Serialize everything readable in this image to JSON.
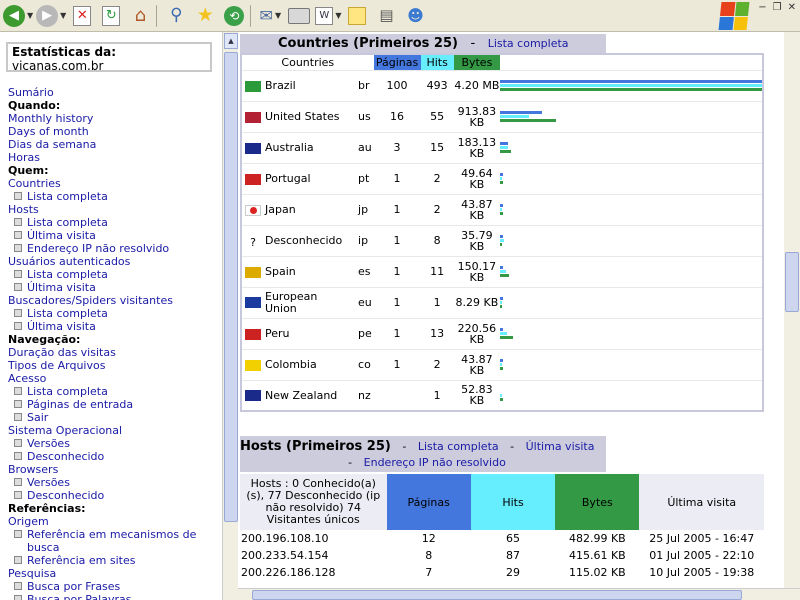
{
  "sidebar": {
    "site_label": "Estatísticas da:",
    "site_name": "vicanas.com.br",
    "menu": [
      {
        "kind": "l",
        "text": "Sumário"
      },
      {
        "kind": "h",
        "text": "Quando:"
      },
      {
        "kind": "l",
        "text": "Monthly history"
      },
      {
        "kind": "l",
        "text": "Days of month"
      },
      {
        "kind": "l",
        "text": "Dias da semana"
      },
      {
        "kind": "l",
        "text": "Horas"
      },
      {
        "kind": "h",
        "text": "Quem:"
      },
      {
        "kind": "l",
        "text": "Countries"
      },
      {
        "kind": "s",
        "text": "Lista completa"
      },
      {
        "kind": "l",
        "text": "Hosts"
      },
      {
        "kind": "s",
        "text": "Lista completa"
      },
      {
        "kind": "s",
        "text": "Última visita"
      },
      {
        "kind": "s",
        "text": "Endereço IP não resolvido"
      },
      {
        "kind": "l",
        "text": "Usuários autenticados"
      },
      {
        "kind": "s",
        "text": "Lista completa"
      },
      {
        "kind": "s",
        "text": "Última visita"
      },
      {
        "kind": "l",
        "text": "Buscadores/Spiders visitantes"
      },
      {
        "kind": "s",
        "text": "Lista completa"
      },
      {
        "kind": "s",
        "text": "Última visita"
      },
      {
        "kind": "h",
        "text": "Navegação:"
      },
      {
        "kind": "l",
        "text": "Duração das visitas"
      },
      {
        "kind": "l",
        "text": "Tipos de Arquivos"
      },
      {
        "kind": "l",
        "text": "Acesso"
      },
      {
        "kind": "s",
        "text": "Lista completa"
      },
      {
        "kind": "s",
        "text": "Páginas de entrada"
      },
      {
        "kind": "s",
        "text": "Sair"
      },
      {
        "kind": "l",
        "text": "Sistema Operacional"
      },
      {
        "kind": "s",
        "text": "Versões"
      },
      {
        "kind": "s",
        "text": "Desconhecido"
      },
      {
        "kind": "l",
        "text": "Browsers"
      },
      {
        "kind": "s",
        "text": "Versões"
      },
      {
        "kind": "s",
        "text": "Desconhecido"
      },
      {
        "kind": "h",
        "text": "Referências:"
      },
      {
        "kind": "l",
        "text": "Origem"
      },
      {
        "kind": "s",
        "text": "Referência em mecanismos de busca"
      },
      {
        "kind": "s",
        "text": "Referência em sites"
      },
      {
        "kind": "l",
        "text": "Pesquisa"
      },
      {
        "kind": "s",
        "text": "Busca por Frases"
      },
      {
        "kind": "s",
        "text": "Busca por Palavras"
      }
    ]
  },
  "countries": {
    "title": "Countries (Primeiros 25)",
    "dash": "-",
    "link": "Lista completa",
    "headers": {
      "country": "Countries",
      "pages": "Páginas",
      "hits": "Hits",
      "bytes": "Bytes"
    },
    "colors": {
      "pages": "#4477dd",
      "hits": "#66eeff",
      "bytes": "#339944"
    },
    "rows": [
      {
        "name": "Brazil",
        "code": "br",
        "pages": "100",
        "hits": "493",
        "bytes": "4.20 MB",
        "bp": 1.0,
        "bh": 1.0,
        "bb": 1.0
      },
      {
        "name": "United States",
        "code": "us",
        "pages": "16",
        "hits": "55",
        "bytes": "913.83 KB",
        "bp": 0.16,
        "bh": 0.112,
        "bb": 0.212
      },
      {
        "name": "Australia",
        "code": "au",
        "pages": "3",
        "hits": "15",
        "bytes": "183.13 KB",
        "bp": 0.03,
        "bh": 0.03,
        "bb": 0.043
      },
      {
        "name": "Portugal",
        "code": "pt",
        "pages": "1",
        "hits": "2",
        "bytes": "49.64 KB",
        "bp": 0.01,
        "bh": 0.004,
        "bb": 0.012
      },
      {
        "name": "Japan",
        "code": "jp",
        "pages": "1",
        "hits": "2",
        "bytes": "43.87 KB",
        "bp": 0.01,
        "bh": 0.004,
        "bb": 0.01
      },
      {
        "name": "Desconhecido",
        "code": "ip",
        "pages": "1",
        "hits": "8",
        "bytes": "35.79 KB",
        "bp": 0.01,
        "bh": 0.016,
        "bb": 0.008
      },
      {
        "name": "Spain",
        "code": "es",
        "pages": "1",
        "hits": "11",
        "bytes": "150.17 KB",
        "bp": 0.01,
        "bh": 0.022,
        "bb": 0.035
      },
      {
        "name": "European Union",
        "code": "eu",
        "pages": "1",
        "hits": "1",
        "bytes": "8.29 KB",
        "bp": 0.01,
        "bh": 0.002,
        "bb": 0.002
      },
      {
        "name": "Peru",
        "code": "pe",
        "pages": "1",
        "hits": "13",
        "bytes": "220.56 KB",
        "bp": 0.01,
        "bh": 0.026,
        "bb": 0.051
      },
      {
        "name": "Colombia",
        "code": "co",
        "pages": "1",
        "hits": "2",
        "bytes": "43.87 KB",
        "bp": 0.01,
        "bh": 0.004,
        "bb": 0.01
      },
      {
        "name": "New Zealand",
        "code": "nz",
        "pages": "",
        "hits": "1",
        "bytes": "52.83 KB",
        "bp": 0.0,
        "bh": 0.002,
        "bb": 0.012
      }
    ]
  },
  "hosts": {
    "title": "Hosts (Primeiros 25)",
    "dash": "-",
    "link_full": "Lista completa",
    "link_last": "Última visita",
    "link_unresolved": "Endereço IP não resolvido",
    "summary": "Hosts : 0 Conhecido(a) (s), 77 Desconhecido (ip não resolvido) 74 Visitantes únicos",
    "headers": {
      "pages": "Páginas",
      "hits": "Hits",
      "bytes": "Bytes",
      "last": "Última visita"
    },
    "rows": [
      {
        "host": "200.196.108.10",
        "pages": "12",
        "hits": "65",
        "bytes": "482.99 KB",
        "last": "25 Jul 2005 - 16:47"
      },
      {
        "host": "200.233.54.154",
        "pages": "8",
        "hits": "87",
        "bytes": "415.61 KB",
        "last": "01 Jul 2005 - 22:10"
      },
      {
        "host": "200.226.186.128",
        "pages": "7",
        "hits": "29",
        "bytes": "115.02 KB",
        "last": "10 Jul 2005 - 19:38"
      }
    ]
  }
}
